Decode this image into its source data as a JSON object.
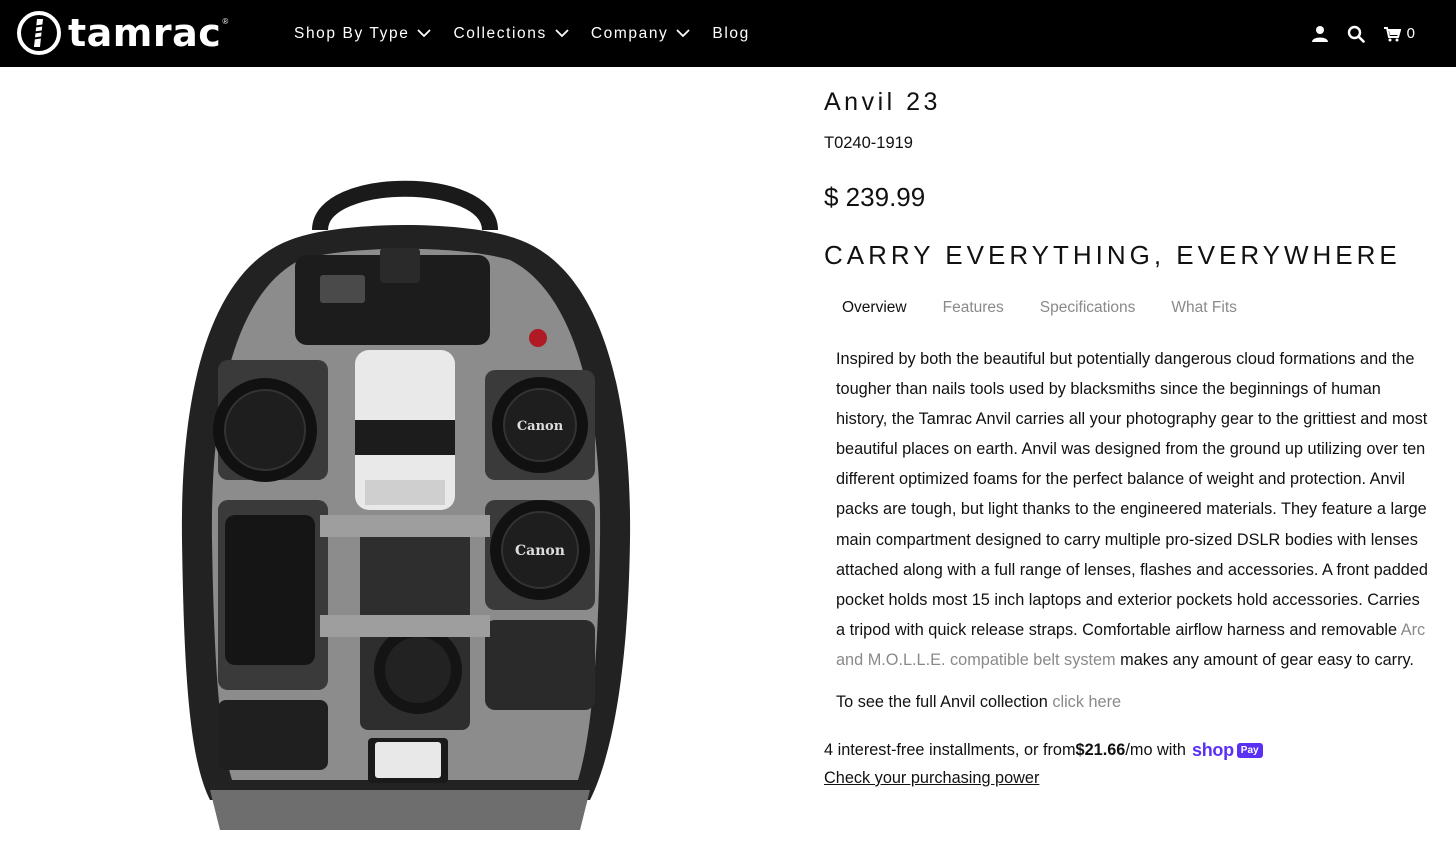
{
  "header": {
    "logo_text": "tamrac",
    "logo_reg": "®",
    "nav": [
      {
        "label": "Shop By Type"
      },
      {
        "label": "Collections"
      },
      {
        "label": "Company"
      },
      {
        "label": "Blog"
      }
    ],
    "cart_count": "0"
  },
  "product": {
    "title": "Anvil 23",
    "sku": "T0240-1919",
    "price": "$ 239.99",
    "tagline": "CARRY EVERYTHING, EVERYWHERE",
    "tabs": [
      "Overview",
      "Features",
      "Specifications",
      "What Fits"
    ],
    "description_part1": "Inspired by both the beautiful but potentially dangerous cloud formations and the tougher than nails tools used by blacksmiths since the beginnings of human history, the Tamrac Anvil carries all your photography gear to the grittiest and most beautiful places on earth. Anvil was designed from the ground up utilizing over ten different optimized foams for the perfect balance of weight and protection. Anvil packs are tough, but light thanks to the engineered materials. They feature a large main compartment designed to carry multiple pro-sized DSLR bodies with lenses attached along with a full range of lenses, flashes and accessories. A front padded pocket holds most 15 inch laptops and exterior pockets hold accessories. Carries a tripod with quick release straps. Comfortable airflow harness and removable ",
    "description_link": "Arc and M.O.L.L.E. compatible belt system",
    "description_part2": " makes any amount of gear easy to carry.",
    "collection_text": "To see the full Anvil collection ",
    "collection_link": "click here",
    "install_prefix": "4 interest-free installments, or from ",
    "install_amount": "$21.66",
    "install_suffix": "/mo with",
    "shop_word": "shop",
    "pay_badge": "Pay",
    "purchasing_power": "Check your purchasing power",
    "lens_brand": "Canon"
  }
}
